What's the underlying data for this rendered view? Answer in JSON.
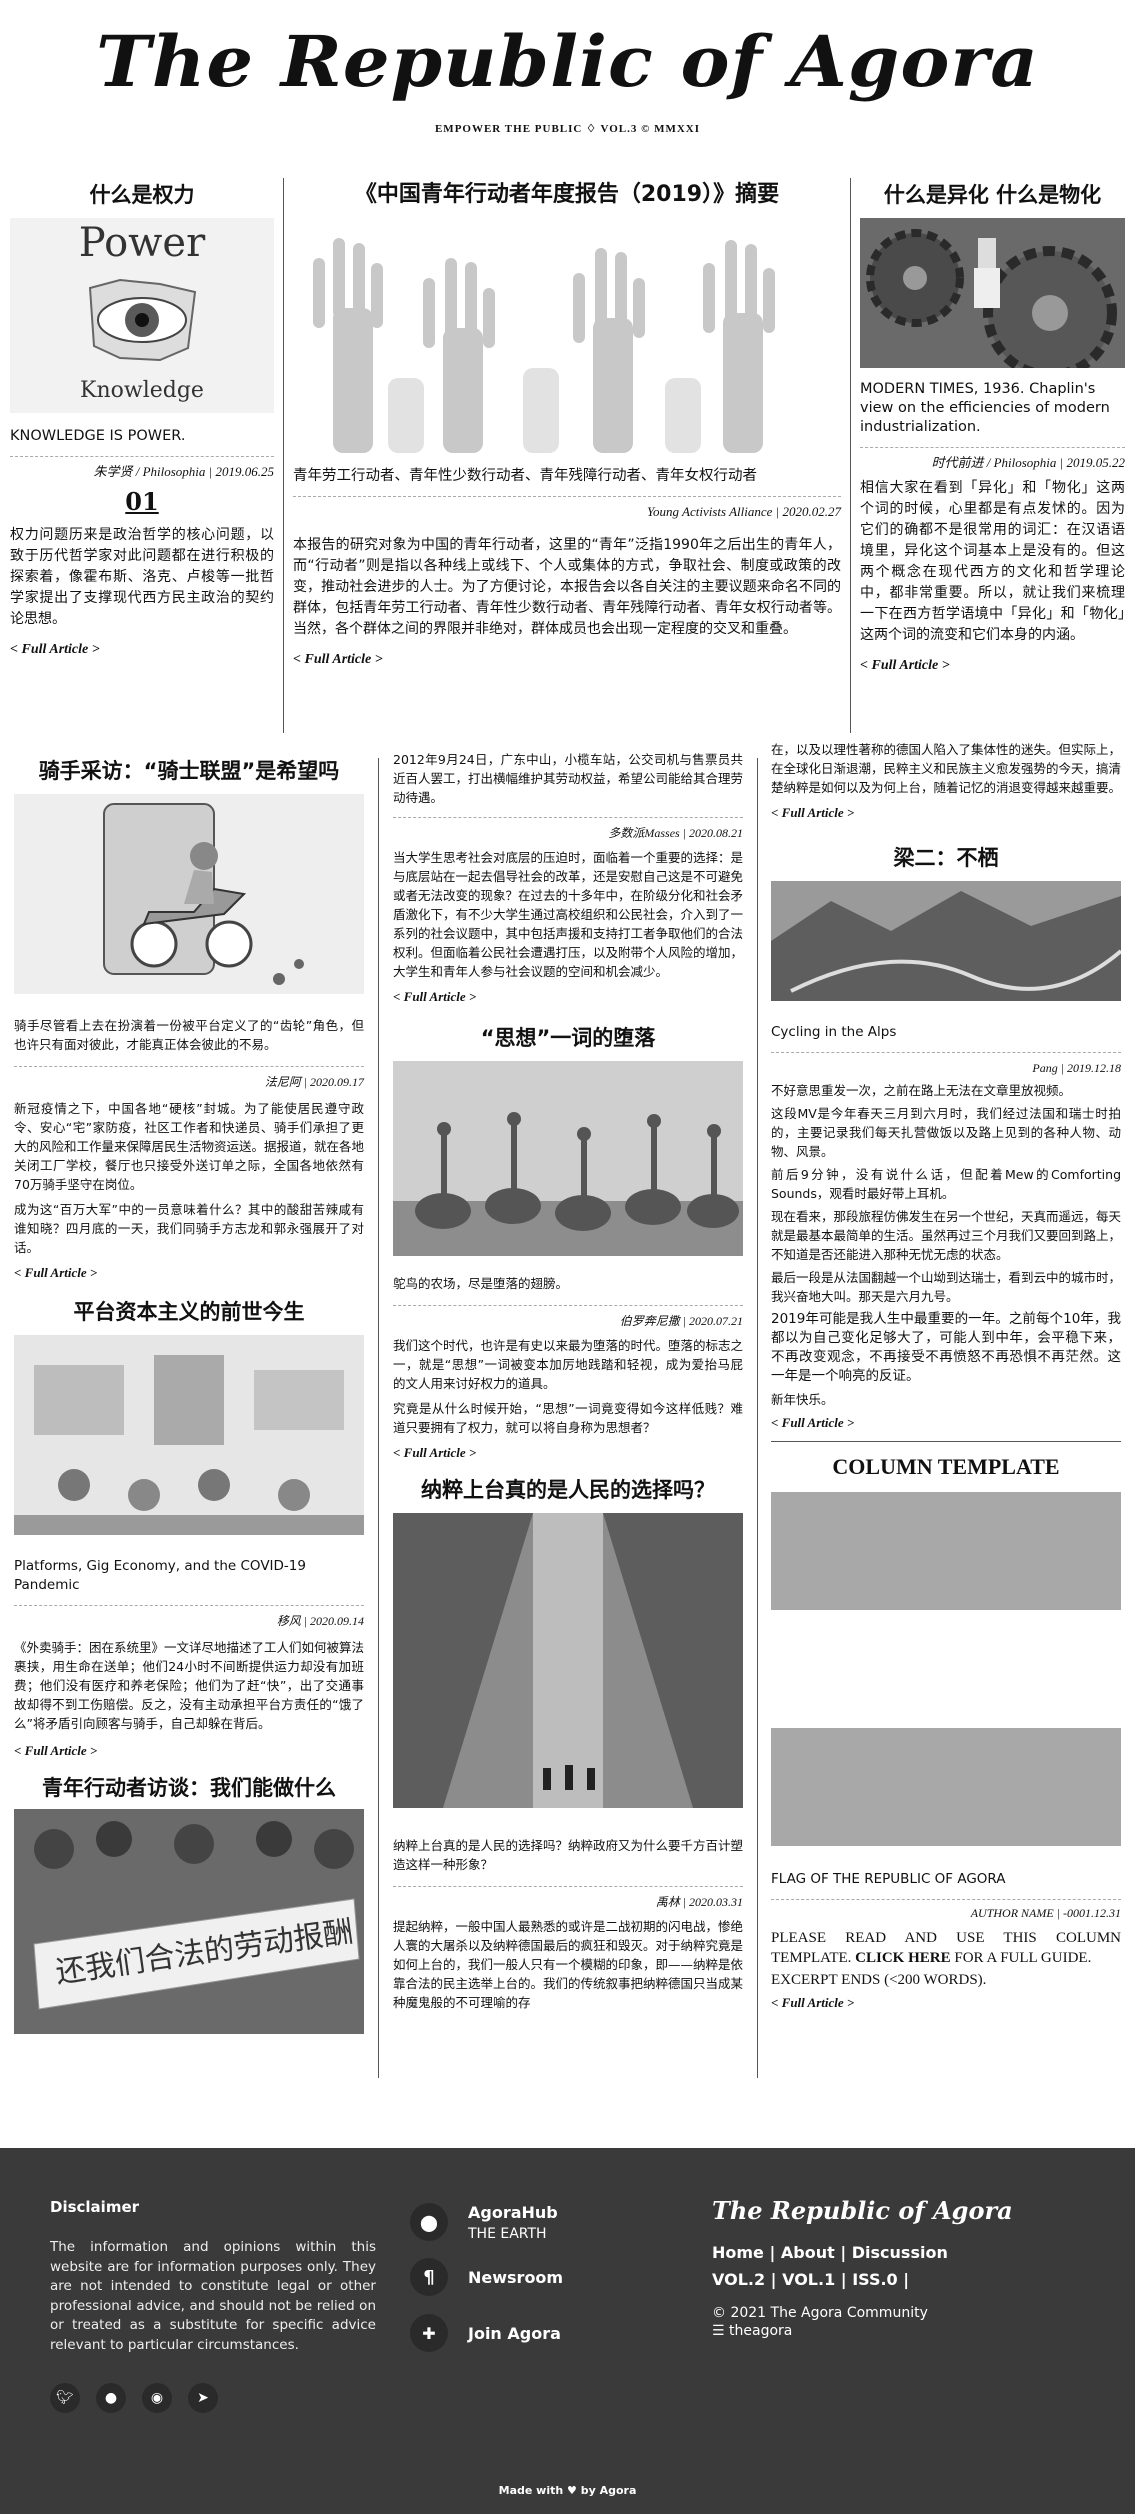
{
  "masthead": {
    "title": "The Republic of Agora",
    "subtitle": "EMPOWER THE PUBLIC ♢ VOL.3 © MMXXI"
  },
  "col_a": {
    "heading": "什么是权力",
    "image_top": "Power",
    "image_bottom": "Knowledge",
    "caption": "KNOWLEDGE IS POWER.",
    "byline": "朱学贤 / Philosophia | 2019.06.25",
    "number": "01",
    "body": "权力问题历来是政治哲学的核心问题，以致于历代哲学家对此问题都在进行积极的探索着，像霍布斯、洛克、卢梭等一批哲学家提出了支撑现代西方民主政治的契约论思想。",
    "link": "< Full Article >"
  },
  "col_b": {
    "heading": "《中国青年行动者年度报告（2019）》摘要",
    "caption": "青年劳工行动者、青年性少数行动者、青年残障行动者、青年女权行动者",
    "byline": "Young Activists Alliance | 2020.02.27",
    "body": "本报告的研究对象为中国的青年行动者，这里的“青年”泛指1990年之后出生的青年人，而“行动者”则是指以各种线上或线下、个人或集体的方式，争取社会、制度或政策的改变，推动社会进步的人士。为了方便讨论，本报告会以各自关注的主要议题来命名不同的群体，包括青年劳工行动者、青年性少数行动者、青年残障行动者、青年女权行动者等。当然，各个群体之间的界限并非绝对，群体成员也会出现一定程度的交叉和重叠。",
    "link": "< Full Article >"
  },
  "col_c": {
    "heading": "什么是异化 什么是物化",
    "caption": "MODERN TIMES, 1936. Chaplin's view on the efficiencies of modern industrialization.",
    "byline": "时代前进 / Philosophia | 2019.05.22",
    "body": "相信大家在看到「异化」和「物化」这两个词的时候，心里都是有点发怵的。因为它们的确都不是很常用的词汇：在汉语语境里，异化这个词基本上是没有的。但这两个概念在现代西方的文化和哲学理论中，都非常重要。所以，就让我们来梳理一下在西方哲学语境中「异化」和「物化」这两个词的流变和它们本身的内涵。",
    "link": "< Full Article >"
  },
  "g1": {
    "a1": {
      "heading": "骑手采访：“骑士联盟”是希望吗",
      "caption": "骑手尽管看上去在扮演着一份被平台定义了的“齿轮”角色，但也许只有面对彼此，才能真正体会彼此的不易。",
      "byline": "法尼阿 | 2020.09.17",
      "p1": "新冠疫情之下，中国各地“硬核”封城。为了能使居民遵守政令、安心“宅”家防疫，社区工作者和快递员、骑手们承担了更大的风险和工作量来保障居民生活物资运送。据报道，就在各地关闭工厂学校，餐厅也只接受外送订单之际，全国各地依然有70万骑手坚守在岗位。",
      "p2": "成为这“百万大军”中的一员意味着什么？其中的酸甜苦辣咸有谁知晓？四月底的一天，我们同骑手方志龙和郭永强展开了对话。",
      "link": "< Full Article >"
    },
    "a2": {
      "heading": "平台资本主义的前世今生",
      "caption": "Platforms, Gig Economy, and the COVID-19 Pandemic",
      "byline": "移风 | 2020.09.14",
      "p1": "《外卖骑手：困在系统里》一文详尽地描述了工人们如何被算法裹挟，用生命在送单；他们24小时不间断提供运力却没有加班费；他们没有医疗和养老保险；他们为了赶“快”，出了交通事故却得不到工伤赔偿。反之，没有主动承担平台方责任的“饿了么”将矛盾引向顾客与骑手，自己却躲在背后。",
      "link": "< Full Article >"
    },
    "a3": {
      "heading": "青年行动者访谈：我们能做什么",
      "banner": "还我们合法的劳动报酬"
    }
  },
  "g2": {
    "a0": {
      "p1": "2012年9月24日，广东中山，小榄车站，公交司机与售票员共近百人罢工，打出横幅维护其劳动权益，希望公司能给其合理劳动待遇。",
      "byline": "多数派Masses | 2020.08.21",
      "p2": "当大学生思考社会对底层的压迫时，面临着一个重要的选择：是与底层站在一起去倡导社会的改革，还是安慰自己这是不可避免或者无法改变的现象？在过去的十多年中，在阶级分化和社会矛盾激化下，有不少大学生通过高校组织和公民社会，介入到了一系列的社会议题中，其中包括声援和支持打工者争取他们的合法权利。但面临着公民社会遭遇打压，以及附带个人风险的增加，大学生和青年人参与社会议题的空间和机会减少。",
      "link": "< Full Article >"
    },
    "a1": {
      "heading": "“思想”一词的堕落",
      "caption": "鸵鸟的农场，尽是堕落的翅膀。",
      "byline": "伯罗奔尼撒 | 2020.07.21",
      "p1": "我们这个时代，也许是有史以来最为堕落的时代。堕落的标志之一，就是“思想”一词被变本加厉地践踏和轻视，成为爱抬马屁的文人用来讨好权力的道具。",
      "p2": "究竟是从什么时候开始，“思想”一词竟变得如今这样低贱？难道只要拥有了权力，就可以将自身称为思想者？",
      "link": "< Full Article >"
    },
    "a2": {
      "heading": "纳粹上台真的是人民的选择吗？",
      "caption": "纳粹上台真的是人民的选择吗？纳粹政府又为什么要千方百计塑造这样一种形象？",
      "byline": "禹林 | 2020.03.31",
      "p1": "提起纳粹，一般中国人最熟悉的或许是二战初期的闪电战，惨绝人寰的大屠杀以及纳粹德国最后的疯狂和毁灭。对于纳粹究竟是如何上台的，我们一般人只有一个模糊的印象，即——纳粹是依靠合法的民主选举上台的。我们的传统叙事把纳粹德国只当成某种魔鬼般的不可理喻的存"
    }
  },
  "g3": {
    "a0": {
      "p1": "在，以及以理性著称的德国人陷入了集体性的迷失。但实际上，在全球化日渐退潮，民粹主义和民族主义愈发强势的今天，搞清楚纳粹是如何以及为何上台，随着记忆的消退变得越来越重要。",
      "link": "< Full Article >"
    },
    "a1": {
      "heading": "梁二：不栖",
      "caption": "Cycling in the Alps",
      "byline": "Pang | 2019.12.18",
      "p1": "不好意思重发一次，之前在路上无法在文章里放视频。",
      "p2": "这段MV是今年春天三月到六月时，我们经过法国和瑞士时拍的，主要记录我们每天扎营做饭以及路上见到的各种人物、动物、风景。",
      "p3": "前后9分钟，没有说什么话，但配着Mew的Comforting Sounds，观看时最好带上耳机。",
      "p4": "现在看来，那段旅程仿佛发生在另一个世纪，天真而遥远，每天就是最基本最简单的生活。虽然再过三个月我们又要回到路上，不知道是否还能进入那种无忧无虑的状态。",
      "p5": "最后一段是从法国翻越一个山坳到达瑞士，看到云中的城市时，我兴奋地大叫。那天是六月九号。",
      "p6": "2019年可能是我人生中最重要的一年。之前每个10年，我都以为自己变化足够大了，可能人到中年，会平稳下来，不再改变观念，不再接受不再愤怒不再恐惧不再茫然。这一年是一个响亮的反证。",
      "p7": "新年快乐。",
      "link": "< Full Article >"
    },
    "a2": {
      "heading": "COLUMN TEMPLATE",
      "caption": "FLAG OF THE REPUBLIC OF AGORA",
      "byline": "AUTHOR NAME | -0001.12.31",
      "p1a": "PLEASE READ AND USE THIS COLUMN TEMPLATE. ",
      "p1b": "CLICK HERE",
      "p1c": " FOR A FULL GUIDE.",
      "p2": "EXCERPT ENDS (<200 WORDS).",
      "link": "< Full Article >"
    }
  },
  "footer": {
    "disclaimer_title": "Disclaimer",
    "disclaimer": "The information and opinions within this website are for information purposes only. They are not intended to constitute legal or other professional advice, and should not be relied on or treated as a substitute for specific advice relevant to particular circumstances.",
    "hub_title": "AgoraHub",
    "hub_sub": "THE EARTH",
    "newsroom": "Newsroom",
    "join": "Join Agora",
    "brand": "The Republic of Agora",
    "links1": [
      "Home",
      "About",
      "Discussion"
    ],
    "links2": [
      "VOL.2",
      "VOL.1",
      "ISS.0"
    ],
    "copyright": "© 2021 The Agora Community",
    "handle": "theagora",
    "made": "Made with ♥ by Agora",
    "icons": [
      "twitter-icon",
      "github-icon",
      "reddit-icon",
      "telegram-icon"
    ]
  }
}
